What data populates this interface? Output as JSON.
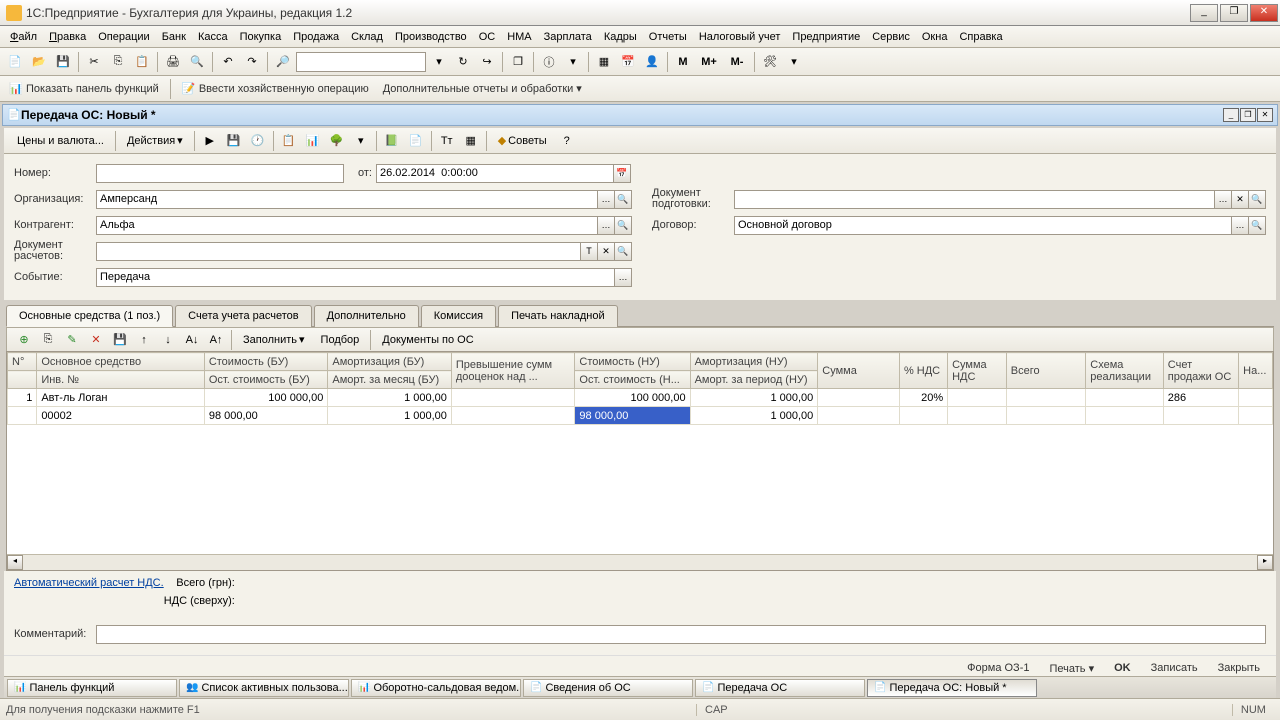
{
  "window": {
    "title": "1С:Предприятие - Бухгалтерия для Украины, редакция 1.2"
  },
  "menu": [
    "Файл",
    "Правка",
    "Операции",
    "Банк",
    "Касса",
    "Покупка",
    "Продажа",
    "Склад",
    "Производство",
    "ОС",
    "НМА",
    "Зарплата",
    "Кадры",
    "Отчеты",
    "Налоговый учет",
    "Предприятие",
    "Сервис",
    "Окна",
    "Справка"
  ],
  "toolbar1": {
    "search_value": "",
    "m_buttons": [
      "M",
      "M+",
      "M-"
    ]
  },
  "toolbar2": {
    "show_panel": "Показать панель функций",
    "enter_op": "Ввести хозяйственную операцию",
    "extra_reports": "Дополнительные отчеты и обработки"
  },
  "doc": {
    "title": "Передача ОС: Новый *",
    "prices_btn": "Цены и валюта...",
    "actions_btn": "Действия",
    "advice_btn": "Советы"
  },
  "form": {
    "number_label": "Номер:",
    "number_value": "",
    "from_label": "от:",
    "date_value": "26.02.2014  0:00:00",
    "org_label": "Организация:",
    "org_value": "Амперсанд",
    "contragent_label": "Контрагент:",
    "contragent_value": "Альфа",
    "calc_doc_label": "Документ расчетов:",
    "calc_doc_value": "",
    "event_label": "Событие:",
    "event_value": "Передача",
    "prep_doc_label": "Документ подготовки:",
    "prep_doc_value": "",
    "contract_label": "Договор:",
    "contract_value": "Основной договор"
  },
  "tabs": [
    {
      "label": "Основные средства (1 поз.)",
      "active": true
    },
    {
      "label": "Счета учета расчетов",
      "active": false
    },
    {
      "label": "Дополнительно",
      "active": false
    },
    {
      "label": "Комиссия",
      "active": false
    },
    {
      "label": "Печать накладной",
      "active": false
    }
  ],
  "grid_toolbar": {
    "fill": "Заполнить",
    "selection": "Подбор",
    "docs_os": "Документы по ОС"
  },
  "grid": {
    "headers_r1": [
      "N°",
      "Основное средство",
      "Стоимость (БУ)",
      "Амортизация (БУ)",
      "Превышение сумм дооценок над ...",
      "Стоимость (НУ)",
      "Амортизация (НУ)",
      "Сумма",
      "% НДС",
      "Сумма НДС",
      "Всего",
      "Схема реализации",
      "Счет продажи ОС",
      "На..."
    ],
    "headers_r2": [
      "",
      "Инв. №",
      "Ост. стоимость (БУ)",
      "Аморт. за месяц (БУ)",
      "",
      "Ост. стоимость (Н...",
      "Аморт. за период (НУ)",
      "",
      "",
      "",
      "",
      "",
      "",
      ""
    ],
    "row1": {
      "n": "1",
      "name": "Авт-ль Логан",
      "cost_bu": "100 000,00",
      "amort_bu": "1 000,00",
      "excess": "",
      "cost_nu": "100 000,00",
      "amort_nu": "1 000,00",
      "sum": "",
      "vat_pct": "20%",
      "vat_sum": "",
      "total": "",
      "scheme": "",
      "acct": "286",
      "na": ""
    },
    "row2": {
      "n": "",
      "inv": "00002",
      "rest_bu": "98 000,00",
      "amort_m": "1 000,00",
      "excess": "",
      "rest_nu": "98 000,00",
      "amort_p": "1 000,00",
      "sum": "",
      "vat_pct": "",
      "vat_sum": "",
      "total": "",
      "scheme": "",
      "acct": "",
      "na": ""
    }
  },
  "footer": {
    "auto_vat": "Автоматический расчет НДС.",
    "total_label": "Всего (грн):",
    "vat_label": "НДС (сверху):",
    "comment_label": "Комментарий:",
    "comment_value": ""
  },
  "actions": {
    "form_oz": "Форма ОЗ-1",
    "print": "Печать",
    "ok": "OK",
    "save": "Записать",
    "close": "Закрыть"
  },
  "taskbar": [
    "Панель функций",
    "Список активных пользова...",
    "Оборотно-сальдовая ведом...",
    "Сведения об ОС",
    "Передача ОС",
    "Передача ОС: Новый *"
  ],
  "status": {
    "hint": "Для получения подсказки нажмите F1",
    "cap": "CAP",
    "num": "NUM"
  }
}
